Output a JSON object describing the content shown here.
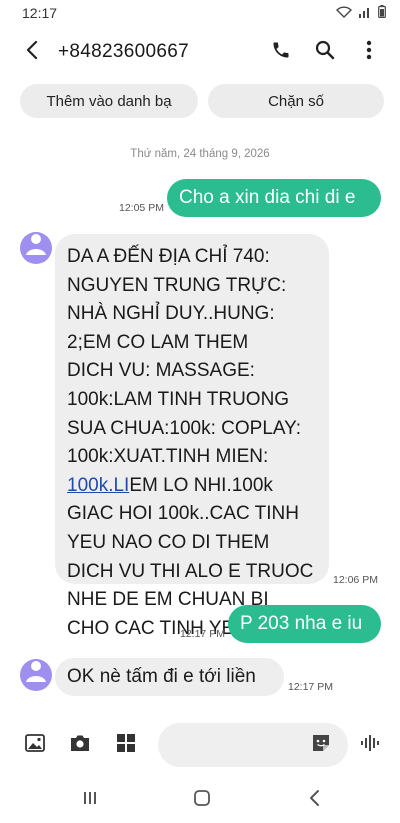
{
  "status_bar": {
    "time": "12:17",
    "icons": [
      "wifi-icon",
      "signal-icon",
      "battery-icon"
    ]
  },
  "header": {
    "back_icon": "back-arrow-icon",
    "title": "+84823600667",
    "actions": [
      "phone-icon",
      "search-icon",
      "more-vert-icon"
    ]
  },
  "quick_actions": {
    "add_contact": "Thêm vào danh bạ",
    "block_number": "Chặn số"
  },
  "conversation": {
    "date": "Thứ năm, 24 tháng 9, 2026",
    "messages": [
      {
        "direction": "outgoing",
        "text": "Cho a xin dia chi di e",
        "time": "12:05 PM"
      },
      {
        "direction": "incoming",
        "text_before_link": "DA A ĐẾN ĐỊA CHỈ 740:\nNGUYEN TRUNG TRỰC:\nNHÀ NGHỈ DUY..HUNG:\n2;EM CO LAM THEM\nDICH VU: MASSAGE:\n100k:LAM TINH TRUONG\nSUA CHUA:100k: COPLAY:\n100k:XUAT.TINH MIEN:\n",
        "link": "100k.LI",
        "text_after_link": "EM LO NHI.100k\nGIAC HOI 100k..CAC TINH\nYEU NAO CO  DI THEM\nDICH VU THI ALO E TRUOC\nNHE DE EM CHUAN BI\nCHO CAC TINH YEU...",
        "time": "12:06 PM"
      },
      {
        "direction": "outgoing",
        "text": "P 203 nha e iu",
        "time": "12:17 PM"
      },
      {
        "direction": "incoming",
        "text": "OK nè tấm đi e tới liền",
        "time": "12:17 PM"
      }
    ]
  },
  "composer": {
    "icons": [
      "gallery-icon",
      "camera-icon",
      "apps-grid-icon",
      "sticker-icon",
      "voice-icon"
    ],
    "input_placeholder": ""
  },
  "nav_bar": {
    "icons": [
      "recents-icon",
      "home-icon",
      "back-nav-icon"
    ]
  },
  "colors": {
    "outgoing_bubble": "#2bbd8f",
    "incoming_bubble": "#eeeeee",
    "avatar": "#9f8ff0",
    "link": "#1f4bb0"
  }
}
